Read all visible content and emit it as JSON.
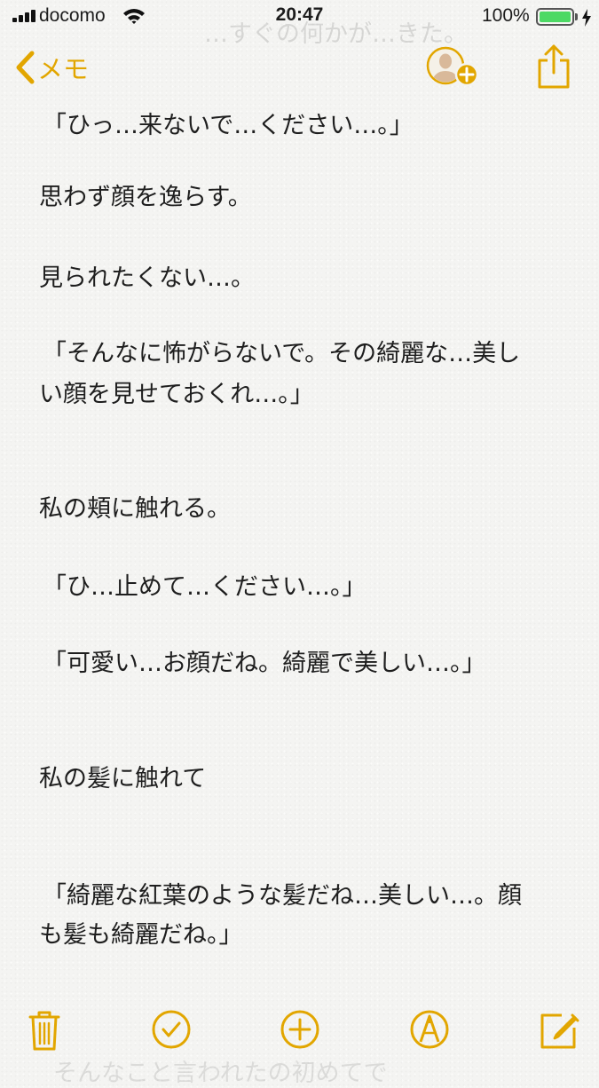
{
  "status_bar": {
    "carrier": "docomo",
    "time": "20:47",
    "battery_percent": "100%",
    "battery_level": 1.0,
    "icons": [
      "signal-bars-icon",
      "wifi-icon",
      "battery-icon",
      "charging-bolt-icon"
    ]
  },
  "nav": {
    "back_label": "メモ",
    "faded_text": "…すぐの何かが…きた。",
    "icons": [
      "chevron-left-icon",
      "add-person-icon",
      "share-icon"
    ]
  },
  "note": {
    "lines": [
      "「ひっ…来ないで…ください…。」",
      "思わず顔を逸らす。",
      "見られたくない…。",
      "「そんなに怖がらないで。その綺麗な…美し",
      "い顔を見せておくれ…。」",
      "私の頬に触れる。",
      "「ひ…止めて…ください…。」",
      "「可愛い…お顔だね。綺麗で美しい…。」",
      "私の髪に触れて",
      "「綺麗な紅葉のような髪だね…美しい…。顔",
      "も髪も綺麗だね。」",
      "そんなこと言われたの初めてで"
    ]
  },
  "toolbar": {
    "icons": [
      "trash-icon",
      "checklist-icon",
      "add-icon",
      "markup-icon",
      "compose-icon"
    ]
  },
  "colors": {
    "accent": "#e2a600",
    "battery_green": "#4cd964",
    "text": "#1e1e1e",
    "paper": "#f4f4f2"
  }
}
